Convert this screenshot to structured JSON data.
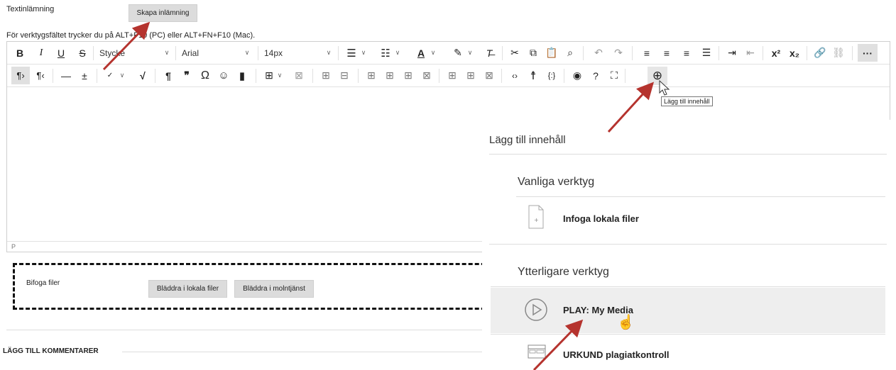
{
  "header": {
    "title": "Textinlämning",
    "create_button": "Skapa inlämning"
  },
  "hint": "För verktygsfältet trycker du på ALT+F10 (PC) eller ALT+FN+F10 (Mac).",
  "toolbar": {
    "style_select": "Stycke",
    "font_select": "Arial",
    "size_select": "14px",
    "tooltip": "Lägg till innehåll"
  },
  "status": {
    "path": "P"
  },
  "attach": {
    "label": "Bifoga filer",
    "browse_local": "Bläddra i lokala filer",
    "browse_cloud": "Bläddra i molntjänst"
  },
  "comments": {
    "label": "LÄGG TILL KOMMENTARER"
  },
  "panel": {
    "title": "Lägg till innehåll",
    "common_heading": "Vanliga verktyg",
    "common_items": [
      {
        "label": "Infoga lokala filer",
        "icon": "file-icon"
      }
    ],
    "more_heading": "Ytterligare verktyg",
    "more_items": [
      {
        "label": "PLAY: My Media",
        "icon": "play-icon"
      },
      {
        "label": "URKUND plagiatkontroll",
        "icon": "window-icon"
      }
    ]
  },
  "colors": {
    "accent_arrow": "#b5332e",
    "hover_row": "#eeeeee",
    "button_bg": "#dcdcdc"
  }
}
